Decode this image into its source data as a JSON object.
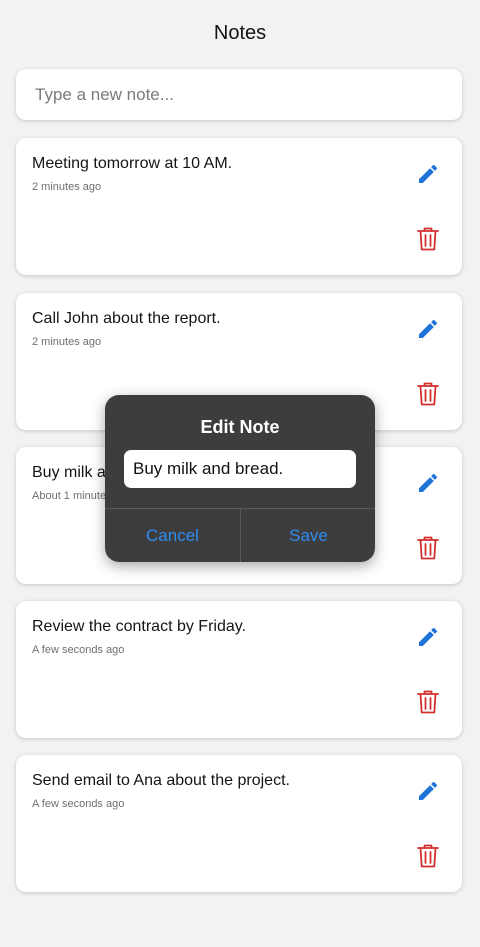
{
  "header": {
    "title": "Notes"
  },
  "new_note": {
    "placeholder": "Type a new note..."
  },
  "notes": [
    {
      "text": "Meeting tomorrow at 10 AM.",
      "time": "2 minutes ago"
    },
    {
      "text": "Call John about the report.",
      "time": "2 minutes ago"
    },
    {
      "text": "Buy milk and bread.",
      "time": "About 1 minute ago"
    },
    {
      "text": "Review the contract by Friday.",
      "time": "A few seconds ago"
    },
    {
      "text": "Send email to Ana about the project.",
      "time": "A few seconds ago"
    }
  ],
  "dialog": {
    "title": "Edit Note",
    "value": "Buy milk and bread.",
    "cancel_label": "Cancel",
    "save_label": "Save"
  },
  "colors": {
    "edit_icon": "#1e73d8",
    "delete_icon": "#d32f2f",
    "dialog_bg": "#3d3d3d",
    "dialog_button": "#2f8cf2"
  },
  "icons": {
    "edit": "pencil-icon",
    "delete": "trash-icon"
  }
}
